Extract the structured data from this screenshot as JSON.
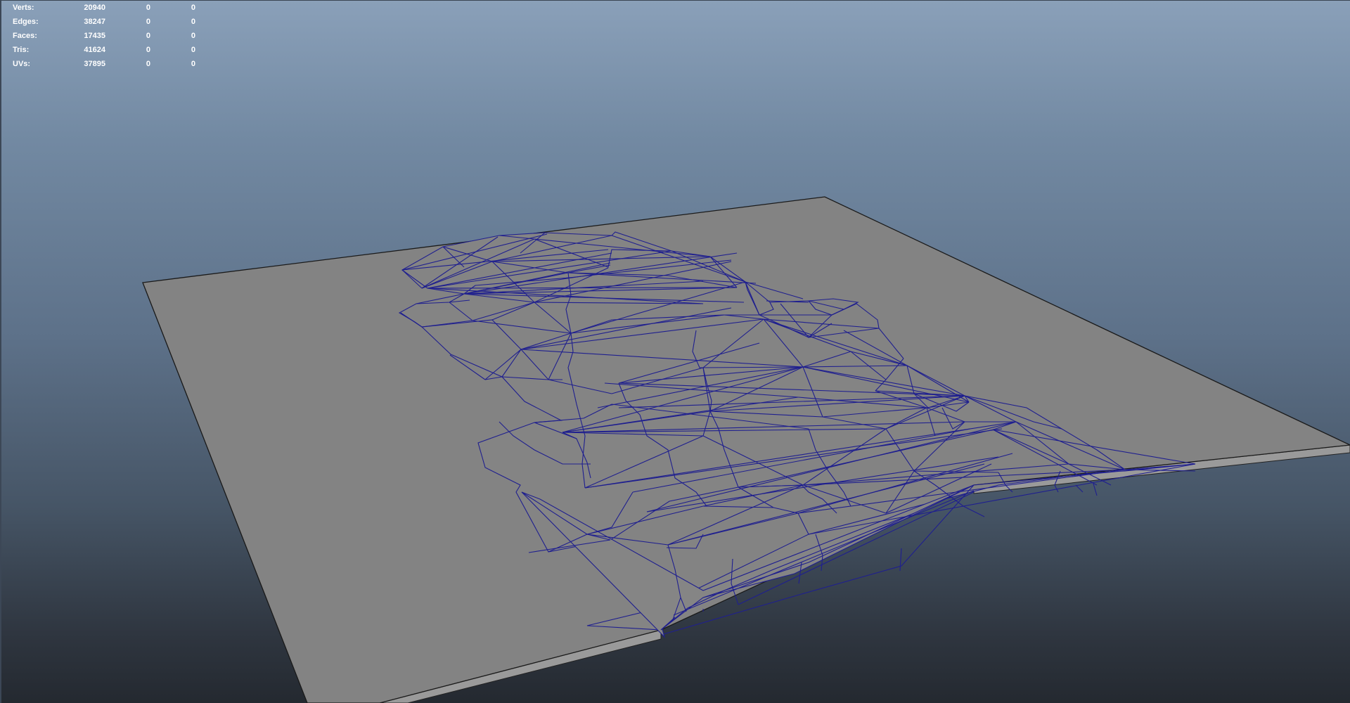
{
  "viewport": {
    "background_top": "#8aa0b9",
    "background_bottom": "#242930",
    "plane_color": "#838383",
    "wire_color": "#1e1e8c"
  },
  "hud": {
    "rows": [
      {
        "label": "Verts:",
        "total": "20940",
        "selected": "0",
        "object": "0"
      },
      {
        "label": "Edges:",
        "total": "38247",
        "selected": "0",
        "object": "0"
      },
      {
        "label": "Faces:",
        "total": "17435",
        "selected": "0",
        "object": "0"
      },
      {
        "label": "Tris:",
        "total": "41624",
        "selected": "0",
        "object": "0"
      },
      {
        "label": "UVs:",
        "total": "37895",
        "selected": "0",
        "object": "0"
      }
    ]
  }
}
